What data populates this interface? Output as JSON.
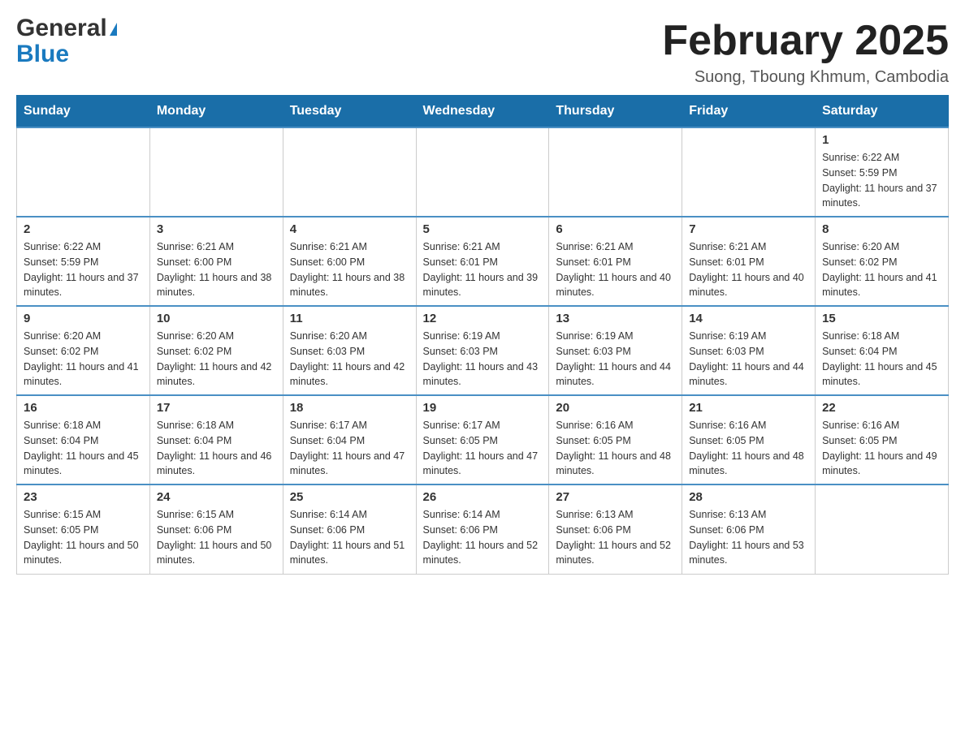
{
  "logo": {
    "general": "General",
    "blue": "Blue",
    "aria": "GeneralBlue logo"
  },
  "header": {
    "month_title": "February 2025",
    "location": "Suong, Tboung Khmum, Cambodia"
  },
  "weekdays": [
    "Sunday",
    "Monday",
    "Tuesday",
    "Wednesday",
    "Thursday",
    "Friday",
    "Saturday"
  ],
  "weeks": [
    [
      {
        "day": "",
        "info": ""
      },
      {
        "day": "",
        "info": ""
      },
      {
        "day": "",
        "info": ""
      },
      {
        "day": "",
        "info": ""
      },
      {
        "day": "",
        "info": ""
      },
      {
        "day": "",
        "info": ""
      },
      {
        "day": "1",
        "info": "Sunrise: 6:22 AM\nSunset: 5:59 PM\nDaylight: 11 hours and 37 minutes."
      }
    ],
    [
      {
        "day": "2",
        "info": "Sunrise: 6:22 AM\nSunset: 5:59 PM\nDaylight: 11 hours and 37 minutes."
      },
      {
        "day": "3",
        "info": "Sunrise: 6:21 AM\nSunset: 6:00 PM\nDaylight: 11 hours and 38 minutes."
      },
      {
        "day": "4",
        "info": "Sunrise: 6:21 AM\nSunset: 6:00 PM\nDaylight: 11 hours and 38 minutes."
      },
      {
        "day": "5",
        "info": "Sunrise: 6:21 AM\nSunset: 6:01 PM\nDaylight: 11 hours and 39 minutes."
      },
      {
        "day": "6",
        "info": "Sunrise: 6:21 AM\nSunset: 6:01 PM\nDaylight: 11 hours and 40 minutes."
      },
      {
        "day": "7",
        "info": "Sunrise: 6:21 AM\nSunset: 6:01 PM\nDaylight: 11 hours and 40 minutes."
      },
      {
        "day": "8",
        "info": "Sunrise: 6:20 AM\nSunset: 6:02 PM\nDaylight: 11 hours and 41 minutes."
      }
    ],
    [
      {
        "day": "9",
        "info": "Sunrise: 6:20 AM\nSunset: 6:02 PM\nDaylight: 11 hours and 41 minutes."
      },
      {
        "day": "10",
        "info": "Sunrise: 6:20 AM\nSunset: 6:02 PM\nDaylight: 11 hours and 42 minutes."
      },
      {
        "day": "11",
        "info": "Sunrise: 6:20 AM\nSunset: 6:03 PM\nDaylight: 11 hours and 42 minutes."
      },
      {
        "day": "12",
        "info": "Sunrise: 6:19 AM\nSunset: 6:03 PM\nDaylight: 11 hours and 43 minutes."
      },
      {
        "day": "13",
        "info": "Sunrise: 6:19 AM\nSunset: 6:03 PM\nDaylight: 11 hours and 44 minutes."
      },
      {
        "day": "14",
        "info": "Sunrise: 6:19 AM\nSunset: 6:03 PM\nDaylight: 11 hours and 44 minutes."
      },
      {
        "day": "15",
        "info": "Sunrise: 6:18 AM\nSunset: 6:04 PM\nDaylight: 11 hours and 45 minutes."
      }
    ],
    [
      {
        "day": "16",
        "info": "Sunrise: 6:18 AM\nSunset: 6:04 PM\nDaylight: 11 hours and 45 minutes."
      },
      {
        "day": "17",
        "info": "Sunrise: 6:18 AM\nSunset: 6:04 PM\nDaylight: 11 hours and 46 minutes."
      },
      {
        "day": "18",
        "info": "Sunrise: 6:17 AM\nSunset: 6:04 PM\nDaylight: 11 hours and 47 minutes."
      },
      {
        "day": "19",
        "info": "Sunrise: 6:17 AM\nSunset: 6:05 PM\nDaylight: 11 hours and 47 minutes."
      },
      {
        "day": "20",
        "info": "Sunrise: 6:16 AM\nSunset: 6:05 PM\nDaylight: 11 hours and 48 minutes."
      },
      {
        "day": "21",
        "info": "Sunrise: 6:16 AM\nSunset: 6:05 PM\nDaylight: 11 hours and 48 minutes."
      },
      {
        "day": "22",
        "info": "Sunrise: 6:16 AM\nSunset: 6:05 PM\nDaylight: 11 hours and 49 minutes."
      }
    ],
    [
      {
        "day": "23",
        "info": "Sunrise: 6:15 AM\nSunset: 6:05 PM\nDaylight: 11 hours and 50 minutes."
      },
      {
        "day": "24",
        "info": "Sunrise: 6:15 AM\nSunset: 6:06 PM\nDaylight: 11 hours and 50 minutes."
      },
      {
        "day": "25",
        "info": "Sunrise: 6:14 AM\nSunset: 6:06 PM\nDaylight: 11 hours and 51 minutes."
      },
      {
        "day": "26",
        "info": "Sunrise: 6:14 AM\nSunset: 6:06 PM\nDaylight: 11 hours and 52 minutes."
      },
      {
        "day": "27",
        "info": "Sunrise: 6:13 AM\nSunset: 6:06 PM\nDaylight: 11 hours and 52 minutes."
      },
      {
        "day": "28",
        "info": "Sunrise: 6:13 AM\nSunset: 6:06 PM\nDaylight: 11 hours and 53 minutes."
      },
      {
        "day": "",
        "info": ""
      }
    ]
  ]
}
